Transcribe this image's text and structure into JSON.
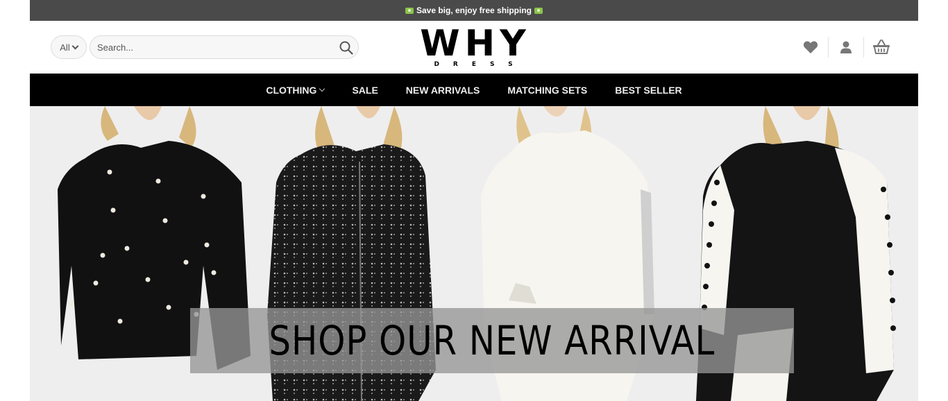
{
  "topbar": {
    "announcement": "Save big, enjoy free shipping",
    "icon": "money-icon"
  },
  "header": {
    "category_select": {
      "value": "All"
    },
    "search": {
      "placeholder": "Search..."
    },
    "logo": {
      "main": "WHY",
      "sub": "DRESS"
    },
    "icons": [
      "heart-icon",
      "user-icon",
      "basket-icon"
    ]
  },
  "nav": {
    "items": [
      {
        "label": "CLOTHING",
        "has_dropdown": true
      },
      {
        "label": "SALE"
      },
      {
        "label": "NEW ARRIVALS"
      },
      {
        "label": "MATCHING SETS"
      },
      {
        "label": "BEST SELLER"
      }
    ]
  },
  "hero": {
    "banner_text": "SHOP OUR NEW ARRIVAL"
  },
  "colors": {
    "topbar_bg": "#4a4a4a",
    "nav_bg": "#000000",
    "hero_bg": "#eeeeee",
    "icon": "#777777"
  }
}
